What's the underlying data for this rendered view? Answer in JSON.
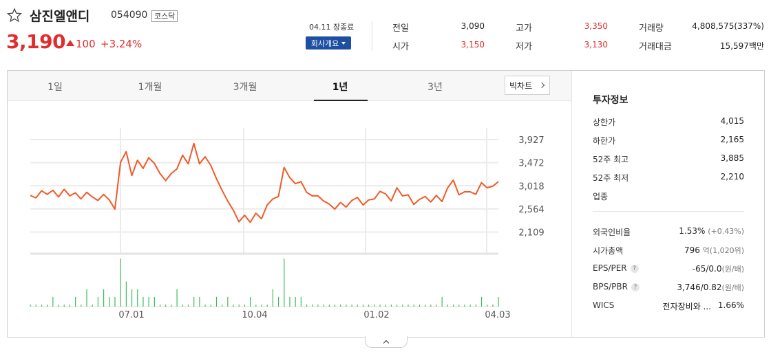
{
  "header": {
    "stock_name": "삼진엘앤디",
    "stock_code": "054090",
    "market": "코스닥",
    "price": "3,190",
    "change": "100",
    "change_pct": "+3.24%",
    "date_status": "04.11 장종료",
    "company_button": "회사개요",
    "colors": {
      "up": "#e12d2d",
      "down": "#2a6acb",
      "brand": "#1e50a2"
    }
  },
  "stats": {
    "prev_close_label": "전일",
    "prev_close": "3,090",
    "open_label": "시가",
    "open": "3,150",
    "high_label": "고가",
    "high": "3,350",
    "low_label": "저가",
    "low": "3,130",
    "volume_label": "거래량",
    "volume": "4,808,575(337%)",
    "value_label": "거래대금",
    "value": "15,597백만"
  },
  "tabs": [
    {
      "label": "1일"
    },
    {
      "label": "1개월"
    },
    {
      "label": "3개월"
    },
    {
      "label": "1년",
      "active": true
    },
    {
      "label": "3년"
    }
  ],
  "big_chart_label": "빅차트",
  "chart_data": {
    "type": "line",
    "y_ticks": [
      "3,927",
      "3,472",
      "3,018",
      "2,564",
      "2,109"
    ],
    "y_tick_values": [
      3927,
      3472,
      3018,
      2564,
      2109
    ],
    "x_ticks": [
      "07.01",
      "10.04",
      "01.02",
      "04.03"
    ],
    "ylim": [
      1900,
      4130
    ],
    "line_color": "#f05a28",
    "volume_color": "#3cbc5c",
    "x": [
      0,
      3,
      6,
      9,
      12,
      15,
      18,
      21,
      24,
      27,
      30,
      33,
      36,
      39,
      42,
      45,
      48,
      51,
      54,
      57,
      60,
      63,
      66,
      69,
      72,
      75,
      78,
      81,
      84,
      87,
      90,
      93,
      96,
      99,
      102,
      105,
      108,
      111,
      114,
      117,
      120,
      123,
      126,
      129,
      132,
      135,
      138,
      141,
      144,
      147,
      150,
      153,
      156,
      159,
      162,
      165,
      168,
      171,
      174,
      177,
      180,
      183,
      186,
      189,
      192,
      195,
      198,
      201,
      204,
      207,
      210,
      213,
      216,
      219,
      222,
      225,
      228,
      231,
      234,
      237,
      240,
      243,
      246,
      249
    ],
    "values": [
      2830,
      2780,
      2920,
      2850,
      2930,
      2800,
      2950,
      2820,
      2880,
      2760,
      2890,
      2800,
      2730,
      2850,
      2740,
      2560,
      3480,
      3690,
      3220,
      3520,
      3360,
      3570,
      3460,
      3260,
      3120,
      3260,
      3350,
      3620,
      3450,
      3850,
      3450,
      3590,
      3420,
      3160,
      2930,
      2720,
      2540,
      2310,
      2440,
      2300,
      2480,
      2370,
      2640,
      2760,
      2810,
      3380,
      3180,
      3060,
      3100,
      2890,
      2820,
      2820,
      2720,
      2660,
      2560,
      2690,
      2600,
      2730,
      2790,
      2640,
      2740,
      2760,
      2910,
      2860,
      2720,
      2980,
      2820,
      2840,
      2650,
      2750,
      2810,
      2700,
      2830,
      2710,
      2980,
      3130,
      2840,
      2900,
      2900,
      2850,
      3080,
      2980,
      3010,
      3100
    ],
    "volume": [
      0,
      0,
      0,
      0,
      1,
      0,
      0,
      0,
      1,
      0,
      2,
      0,
      1,
      2,
      1,
      1,
      6,
      3,
      2,
      2,
      1,
      1,
      1,
      0,
      0,
      0,
      2,
      0,
      0,
      1,
      1,
      0,
      0,
      1,
      0,
      1,
      0,
      0,
      0,
      1,
      0,
      0,
      0,
      2,
      1,
      6,
      1,
      1,
      1,
      0,
      0,
      0,
      0,
      0,
      0,
      0,
      0,
      0,
      0,
      0,
      0,
      0,
      0,
      0,
      0,
      0,
      0,
      0,
      0,
      0,
      0,
      0,
      0,
      1,
      0,
      0,
      0,
      0,
      0,
      0,
      1,
      0,
      0,
      1
    ]
  },
  "info": {
    "title": "투자정보",
    "upper_limit_label": "상한가",
    "upper_limit": "4,015",
    "lower_limit_label": "하한가",
    "lower_limit": "2,165",
    "high52_label": "52주 최고",
    "high52": "3,885",
    "low52_label": "52주 최저",
    "low52": "2,210",
    "sector_label": "업종",
    "foreign_label": "외국인비율",
    "foreign": "1.53%",
    "foreign_change": "(+0.43%)",
    "mcap_label": "시가총액",
    "mcap": "796",
    "mcap_unit": "억",
    "mcap_usd": "(1,020위)",
    "eps_label": "EPS/PER",
    "eps": "-65/0.0",
    "eps_unit": "(원/배)",
    "bps_label": "BPS/PBR",
    "bps": "3,746/0.82",
    "bps_unit": "(원/배)",
    "wics_label": "WICS",
    "wics_name": "전자장비와 ...",
    "wics_pct": "1.66%",
    "help_icon_text": "?"
  }
}
